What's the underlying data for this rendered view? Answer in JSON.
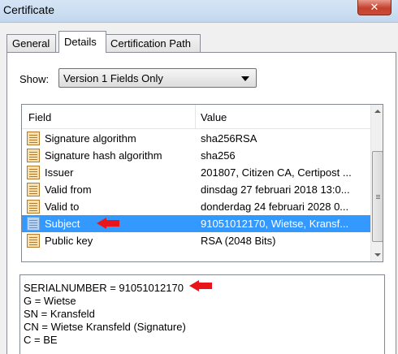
{
  "window": {
    "title": "Certificate",
    "close_label": "✕"
  },
  "tabs": [
    {
      "label": "General",
      "active": false
    },
    {
      "label": "Details",
      "active": true
    },
    {
      "label": "Certification Path",
      "active": false
    }
  ],
  "show": {
    "label": "Show:",
    "selected": "Version 1 Fields Only"
  },
  "fields_table": {
    "columns": [
      "Field",
      "Value"
    ],
    "rows": [
      {
        "field": "Signature algorithm",
        "value": "sha256RSA",
        "selected": false
      },
      {
        "field": "Signature hash algorithm",
        "value": "sha256",
        "selected": false
      },
      {
        "field": "Issuer",
        "value": "201807, Citizen CA, Certipost ...",
        "selected": false
      },
      {
        "field": "Valid from",
        "value": "dinsdag 27 februari 2018 13:0...",
        "selected": false
      },
      {
        "field": "Valid to",
        "value": "donderdag 24 februari 2028 0...",
        "selected": false
      },
      {
        "field": "Subject",
        "value": "91051012170, Wietse, Kransf...",
        "selected": true
      },
      {
        "field": "Public key",
        "value": "RSA (2048 Bits)",
        "selected": false
      }
    ]
  },
  "detail_lines": [
    "SERIALNUMBER = 91051012170",
    "G = Wietse",
    "SN = Kransfeld",
    "CN = Wietse Kransfeld (Signature)",
    "C = BE"
  ],
  "colors": {
    "selection": "#3399ff",
    "annotation_arrow": "#e8161b"
  }
}
